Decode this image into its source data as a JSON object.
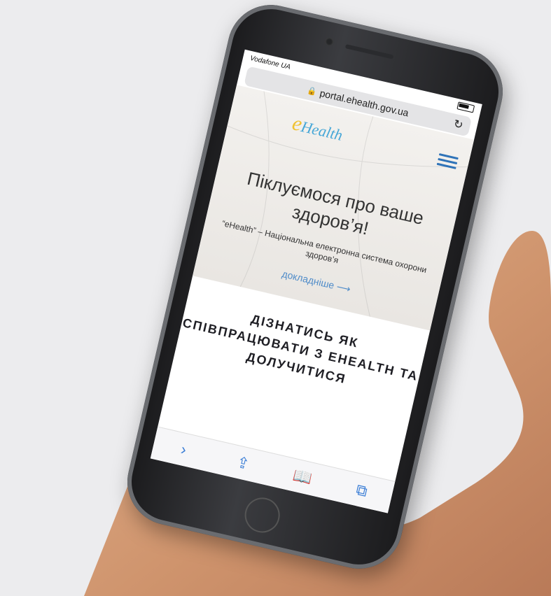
{
  "status": {
    "carrier": "Vodafone UA"
  },
  "url_bar": {
    "url": "portal.ehealth.gov.ua"
  },
  "site": {
    "logo_text_e": "e",
    "logo_text_rest": "Health",
    "hero_title": "Піклуємося про ваше здоров’я!",
    "hero_subtitle": "“eHealth” – Національна електронна система охорони здоров’я",
    "hero_link": "докладніше ⟶",
    "cta_title": "ДІЗНАТИСЬ ЯК СПІВПРАЦЮВАТИ З EHEALTH ТА ДОЛУЧИТИСЯ"
  },
  "toolbar": {
    "icons": [
      "forward-icon",
      "share-icon",
      "bookmarks-icon",
      "tabs-icon"
    ]
  },
  "colors": {
    "brand_blue": "#47a7d7",
    "brand_yellow": "#f0c230",
    "link_blue": "#4f8cc9"
  }
}
